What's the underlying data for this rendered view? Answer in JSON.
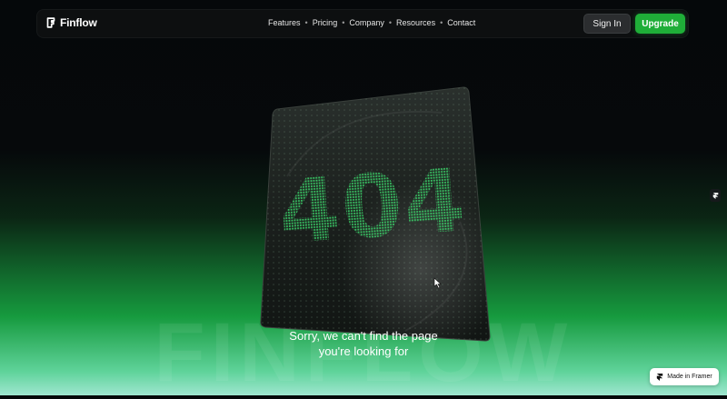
{
  "header": {
    "brand": "Finflow",
    "nav": [
      {
        "label": "Features"
      },
      {
        "label": "Pricing"
      },
      {
        "label": "Company"
      },
      {
        "label": "Resources"
      },
      {
        "label": "Contact"
      }
    ],
    "signin_label": "Sign In",
    "upgrade_label": "Upgrade"
  },
  "hero": {
    "error_code": "404",
    "message_line1": "Sorry, we can't find the page",
    "message_line2": "you're looking for",
    "background_word": "FINFLOW"
  },
  "badge": {
    "label": "Made in Framer"
  },
  "colors": {
    "accent": "#1fae38",
    "glow": "#3ddc6e",
    "background": "#05080a"
  },
  "icons": [
    "finflow-logo-icon",
    "framer-icon",
    "cursor-icon"
  ]
}
